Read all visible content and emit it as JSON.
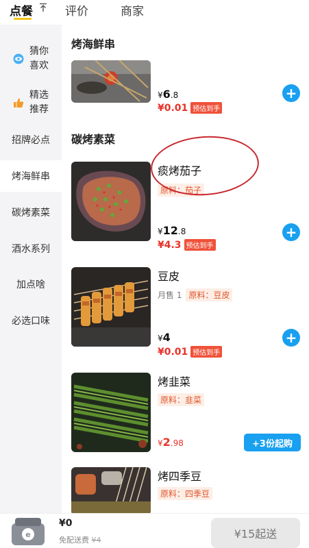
{
  "tabs": {
    "order": "点餐",
    "reviews": "评价",
    "merchant": "商家"
  },
  "sidebar": {
    "items": [
      {
        "label": "猜你\n喜欢",
        "line1": "猜你",
        "line2": "喜欢",
        "icon": "eye-icon"
      },
      {
        "label": "精选推荐",
        "line1": "精选",
        "line2": "推荐",
        "icon": "thumbs-up-icon"
      },
      {
        "label": "招牌必点"
      },
      {
        "label": "烤海鲜串"
      },
      {
        "label": "碳烤素菜"
      },
      {
        "label": "酒水系列"
      },
      {
        "label": "加点啥"
      },
      {
        "label": "必选口味"
      }
    ],
    "active_index": 3
  },
  "sections": {
    "seafood_title": "烤海鲜串",
    "veg_title": "碳烤素菜"
  },
  "items": [
    {
      "name": "",
      "price_symbol": "¥",
      "price_int": "6",
      "price_dec": ".8",
      "sub_price": "¥0.01",
      "badge": "预估到手"
    },
    {
      "name": "痰烤茄子",
      "tag": "原料：茄子",
      "price_symbol": "¥",
      "price_int": "12",
      "price_dec": ".8",
      "sub_price": "¥4.3",
      "badge": "预估到手"
    },
    {
      "name": "豆皮",
      "sales": "月售 1",
      "tag": "原料：豆皮",
      "price_symbol": "¥",
      "price_int": "4",
      "sub_price": "¥0.01",
      "badge": "预估到手"
    },
    {
      "name": "烤韭菜",
      "tag": "原料：韭菜",
      "price_symbol": "¥",
      "price_int": "2",
      "price_dec": ".98",
      "min_order": "+3份起购"
    },
    {
      "name": "烤四季豆",
      "tag": "原料：四季豆"
    }
  ],
  "bottom": {
    "total": "¥0",
    "delivery_label": "免配送费",
    "delivery_original": "¥4",
    "checkout": "¥15起送"
  },
  "colors": {
    "accent": "#19a0f0",
    "price_red": "#e8332a",
    "tag_orange": "#e0562c",
    "annotation": "#c8272e"
  }
}
